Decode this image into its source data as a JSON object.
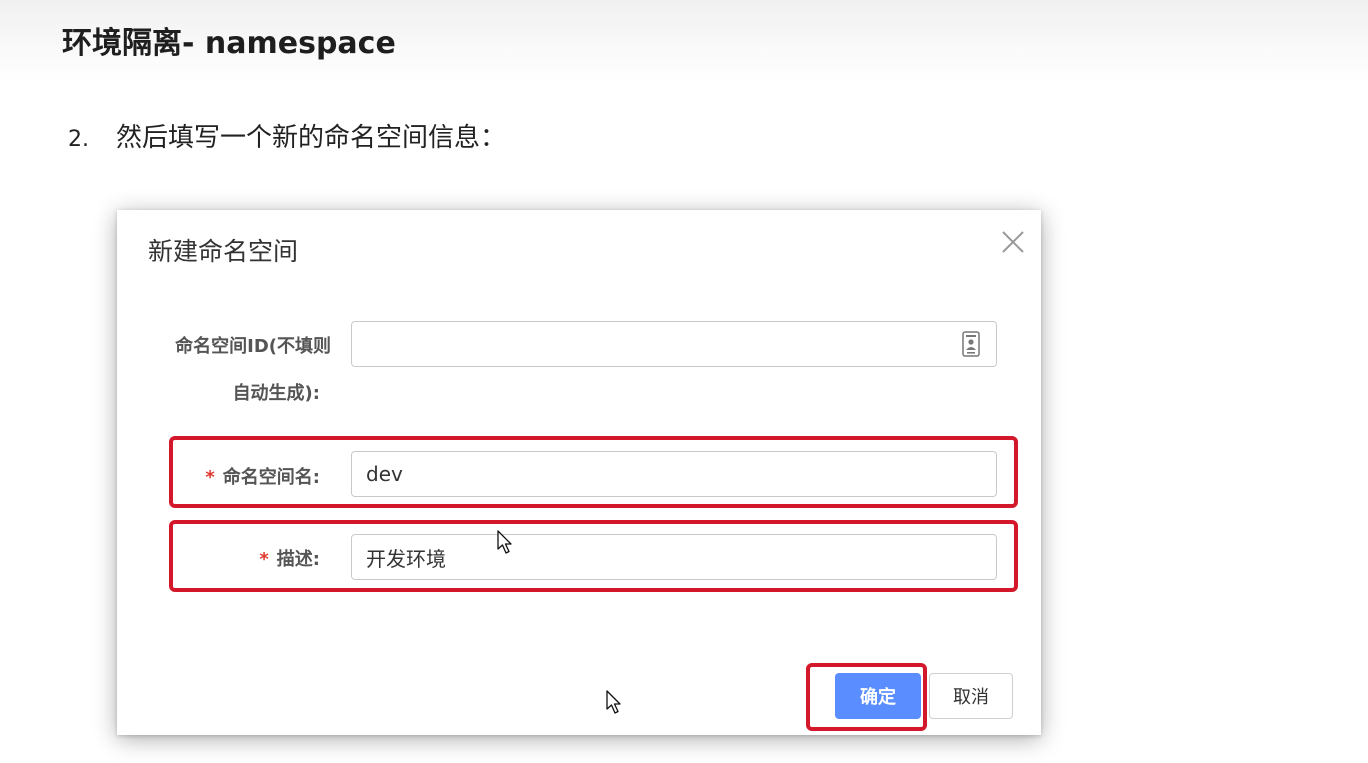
{
  "slide": {
    "title": "环境隔离- namespace",
    "step_number": "2.",
    "step_text": "然后填写一个新的命名空间信息："
  },
  "dialog": {
    "title": "新建命名空间",
    "close_icon": "close-icon",
    "fields": {
      "namespace_id": {
        "label_line1": "命名空间ID(不填则",
        "label_line2": "自动生成):",
        "value": "",
        "icon": "contact-card-icon"
      },
      "namespace_name": {
        "required_mark": "*",
        "label": "命名空间名:",
        "value": "dev"
      },
      "description": {
        "required_mark": "*",
        "label": "描述:",
        "value": "开发环境"
      }
    },
    "buttons": {
      "confirm_label": "确定",
      "cancel_label": "取消"
    }
  },
  "colors": {
    "highlight": "#d4182b",
    "primary": "#5a8dff",
    "required": "#e0382d"
  }
}
